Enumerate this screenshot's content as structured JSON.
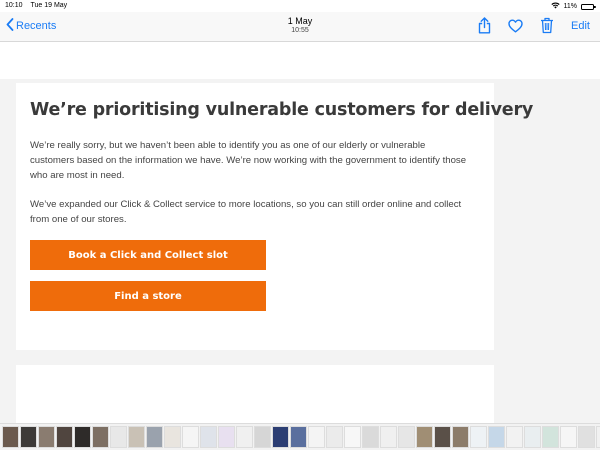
{
  "status_bar": {
    "time": "10:10",
    "date": "Tue 19 May",
    "battery": "11%",
    "battery_level": 0.11
  },
  "nav": {
    "back_label": "Recents",
    "title_date": "1 May",
    "title_time": "10:55",
    "edit_label": "Edit"
  },
  "message": {
    "heading": "We’re prioritising vulnerable customers for delivery",
    "paragraph1": "We’re really sorry, but we haven’t been able to identify you as one of our elderly or vulnerable customers based on the information we have. We’re now working with the government to identify those who are most in need.",
    "paragraph2": "We’ve expanded our Click & Collect service to more locations, so you can still order online and collect from one of our stores.",
    "button1": "Book a Click and Collect slot",
    "button2": "Find a store"
  },
  "colors": {
    "accent": "#ef6c0b",
    "ios_blue": "#1a7cf5"
  },
  "thumbnails": [
    "#6b5a4e",
    "#3d3a38",
    "#8a7c70",
    "#50453f",
    "#2e2b29",
    "#7d6f63",
    "#e8e8e8",
    "#c9c1b5",
    "#9aa2ad",
    "#e9e5df",
    "#f5f5f5",
    "#dfe3ea",
    "#e8e0f0",
    "#f0f0f0",
    "#d6d6d6",
    "#2c3e73",
    "#5a6f9e",
    "#f4f4f4",
    "#ebebeb",
    "#f7f7f7",
    "#dadada",
    "#f0f0f0",
    "#e6e6e6",
    "#a08e74",
    "#5a5048",
    "#8c7c6a",
    "#eef2f5",
    "#c5d7e8",
    "#f2f2f2",
    "#e9eef0",
    "#d2e4dc",
    "#f6f6f6",
    "#e0e0e0",
    "#f1f1f1",
    "#ebe6dc",
    "#d8cfbd",
    "#efefef",
    "#c9b58f",
    "#e8e8e8"
  ]
}
